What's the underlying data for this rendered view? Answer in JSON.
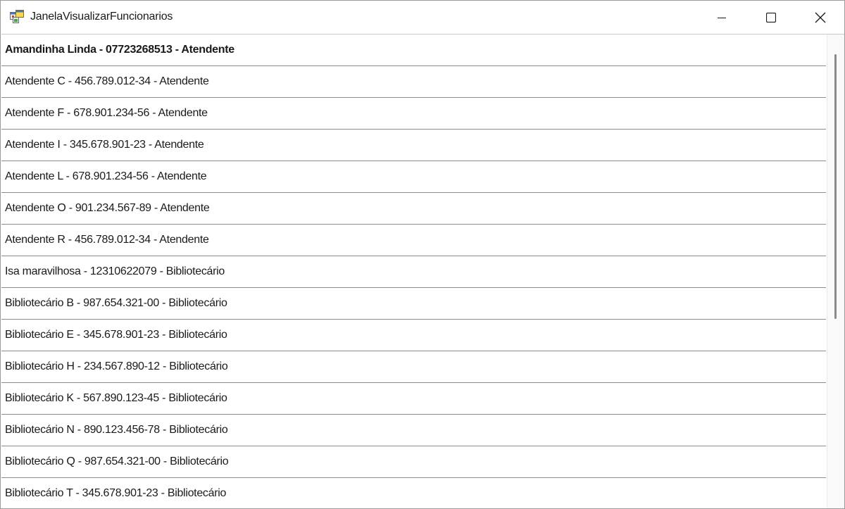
{
  "window": {
    "title": "JanelaVisualizarFuncionarios"
  },
  "employees": [
    "Amandinha Linda - 07723268513 - Atendente",
    "Atendente C - 456.789.012-34 - Atendente",
    "Atendente F - 678.901.234-56 - Atendente",
    "Atendente I - 345.678.901-23 - Atendente",
    "Atendente L - 678.901.234-56 - Atendente",
    "Atendente O - 901.234.567-89 - Atendente",
    "Atendente R - 456.789.012-34 - Atendente",
    "Isa maravilhosa - 12310622079 - Bibliotecário",
    "Bibliotecário B - 987.654.321-00 - Bibliotecário",
    "Bibliotecário E - 345.678.901-23 - Bibliotecário",
    "Bibliotecário H - 234.567.890-12 - Bibliotecário",
    "Bibliotecário K - 567.890.123-45 - Bibliotecário",
    "Bibliotecário N - 890.123.456-78 - Bibliotecário",
    "Bibliotecário Q - 987.654.321-00 - Bibliotecário",
    "Bibliotecário T - 345.678.901-23 - Bibliotecário"
  ],
  "icons": {
    "app": "app-window-icon",
    "minimize": "minimize-icon",
    "maximize": "maximize-icon",
    "close": "close-icon"
  }
}
